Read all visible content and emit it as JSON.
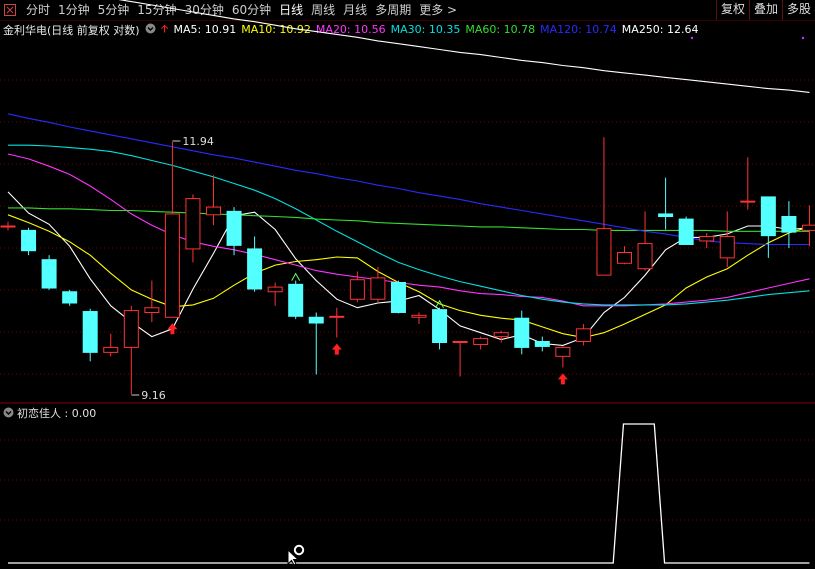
{
  "toolbar": {
    "tabs": [
      "分时",
      "1分钟",
      "5分钟",
      "15分钟",
      "30分钟",
      "60分钟",
      "日线",
      "周线",
      "月线",
      "多周期",
      "更多 >"
    ],
    "active_tab": 6,
    "right_buttons": [
      "复权",
      "叠加",
      "多股"
    ]
  },
  "stock_title": "金利华电(日线 前复权 对数)",
  "ma_labels": [
    {
      "text": "MA5: 10.91",
      "color": "#ffffff"
    },
    {
      "text": "MA10: 10.92",
      "color": "#ffff00"
    },
    {
      "text": "MA20: 10.56",
      "color": "#ff33ff"
    },
    {
      "text": "MA30: 10.35",
      "color": "#00e0e0"
    },
    {
      "text": "MA60: 10.78",
      "color": "#33dd33"
    },
    {
      "text": "MA120: 10.74",
      "color": "#2a2aff"
    },
    {
      "text": "MA250: 12.64",
      "color": "#ffffff"
    }
  ],
  "indicator_label": "初恋佳人 : 0.00",
  "colors": {
    "up": "#ff3232",
    "down": "#54ffff",
    "grid": "#7a0000"
  },
  "chart_data": {
    "type": "candlestick",
    "scale": "log",
    "price_range": [
      9.0,
      12.6
    ],
    "annotations": [
      {
        "text": "11.94",
        "candle": 8,
        "price": 11.94
      },
      {
        "text": "9.16",
        "candle": 6,
        "price": 9.16
      }
    ],
    "candles": [
      {
        "o": 10.93,
        "h": 10.98,
        "l": 10.88,
        "c": 10.93
      },
      {
        "o": 10.88,
        "h": 10.91,
        "l": 10.6,
        "c": 10.65
      },
      {
        "o": 10.55,
        "h": 10.6,
        "l": 10.22,
        "c": 10.24
      },
      {
        "o": 10.2,
        "h": 10.22,
        "l": 10.05,
        "c": 10.08
      },
      {
        "o": 9.99,
        "h": 10.02,
        "l": 9.48,
        "c": 9.57
      },
      {
        "o": 9.57,
        "h": 9.76,
        "l": 9.53,
        "c": 9.62
      },
      {
        "o": 9.62,
        "h": 10.05,
        "l": 9.16,
        "c": 10.0
      },
      {
        "o": 9.98,
        "h": 10.32,
        "l": 9.88,
        "c": 10.03
      },
      {
        "o": 9.93,
        "h": 11.94,
        "l": 9.93,
        "c": 11.07
      },
      {
        "o": 10.67,
        "h": 11.3,
        "l": 10.52,
        "c": 11.25
      },
      {
        "o": 11.06,
        "h": 11.53,
        "l": 10.94,
        "c": 11.15
      },
      {
        "o": 11.1,
        "h": 11.15,
        "l": 10.6,
        "c": 10.71
      },
      {
        "o": 10.67,
        "h": 10.81,
        "l": 10.2,
        "c": 10.23
      },
      {
        "o": 10.2,
        "h": 10.3,
        "l": 10.05,
        "c": 10.25
      },
      {
        "o": 10.28,
        "h": 10.32,
        "l": 9.91,
        "c": 9.94
      },
      {
        "o": 9.93,
        "h": 9.98,
        "l": 9.35,
        "c": 9.87
      },
      {
        "o": 9.93,
        "h": 10.03,
        "l": 9.72,
        "c": 9.94
      },
      {
        "o": 10.12,
        "h": 10.42,
        "l": 10.09,
        "c": 10.33
      },
      {
        "o": 10.12,
        "h": 10.47,
        "l": 10.09,
        "c": 10.35
      },
      {
        "o": 10.3,
        "h": 10.32,
        "l": 9.97,
        "c": 9.98
      },
      {
        "o": 9.93,
        "h": 9.98,
        "l": 9.86,
        "c": 9.95
      },
      {
        "o": 10.01,
        "h": 10.03,
        "l": 9.6,
        "c": 9.67
      },
      {
        "o": 9.68,
        "h": 9.68,
        "l": 9.33,
        "c": 9.68
      },
      {
        "o": 9.65,
        "h": 9.73,
        "l": 9.6,
        "c": 9.71
      },
      {
        "o": 9.73,
        "h": 9.79,
        "l": 9.67,
        "c": 9.77
      },
      {
        "o": 9.92,
        "h": 10.0,
        "l": 9.55,
        "c": 9.62
      },
      {
        "o": 9.68,
        "h": 9.73,
        "l": 9.58,
        "c": 9.63
      },
      {
        "o": 9.53,
        "h": 9.63,
        "l": 9.42,
        "c": 9.62
      },
      {
        "o": 9.68,
        "h": 9.86,
        "l": 9.64,
        "c": 9.81
      },
      {
        "o": 10.38,
        "h": 12.0,
        "l": 10.38,
        "c": 10.9
      },
      {
        "o": 10.51,
        "h": 10.7,
        "l": 10.5,
        "c": 10.63
      },
      {
        "o": 10.45,
        "h": 11.1,
        "l": 10.43,
        "c": 10.73
      },
      {
        "o": 11.07,
        "h": 11.5,
        "l": 10.89,
        "c": 11.04
      },
      {
        "o": 11.01,
        "h": 11.04,
        "l": 10.72,
        "c": 10.72
      },
      {
        "o": 10.76,
        "h": 10.85,
        "l": 10.68,
        "c": 10.81
      },
      {
        "o": 10.57,
        "h": 11.1,
        "l": 10.47,
        "c": 10.81
      },
      {
        "o": 11.22,
        "h": 11.75,
        "l": 11.12,
        "c": 11.22
      },
      {
        "o": 11.27,
        "h": 11.27,
        "l": 10.57,
        "c": 10.82
      },
      {
        "o": 11.04,
        "h": 11.22,
        "l": 10.68,
        "c": 10.86
      },
      {
        "o": 10.88,
        "h": 11.17,
        "l": 10.7,
        "c": 10.94
      }
    ],
    "ma_series": [
      {
        "name": "MA5",
        "color": "#ffffff",
        "values": [
          11.33,
          11.08,
          10.95,
          10.7,
          10.34,
          10.05,
          9.88,
          9.73,
          9.81,
          10.23,
          10.62,
          11.05,
          11.09,
          10.89,
          10.56,
          10.32,
          10.12,
          10.03,
          10.08,
          10.1,
          10.16,
          10.01,
          9.84,
          9.77,
          9.7,
          9.75,
          9.66,
          9.64,
          9.72,
          9.98,
          10.14,
          10.38,
          10.66,
          10.8,
          10.8,
          10.84,
          10.93,
          10.93,
          10.89,
          10.91
        ]
      },
      {
        "name": "MA10",
        "color": "#ffff00",
        "values": [
          11.06,
          10.97,
          10.87,
          10.75,
          10.6,
          10.4,
          10.22,
          10.12,
          10.04,
          10.06,
          10.13,
          10.27,
          10.4,
          10.49,
          10.53,
          10.55,
          10.58,
          10.57,
          10.42,
          10.3,
          10.2,
          10.07,
          10.0,
          9.95,
          9.92,
          9.9,
          9.83,
          9.76,
          9.72,
          9.77,
          9.86,
          9.96,
          10.06,
          10.24,
          10.36,
          10.45,
          10.6,
          10.74,
          10.85,
          10.92
        ]
      },
      {
        "name": "MA20",
        "color": "#ff33ff",
        "values": [
          11.79,
          11.73,
          11.64,
          11.54,
          11.4,
          11.24,
          11.07,
          10.94,
          10.83,
          10.75,
          10.7,
          10.66,
          10.61,
          10.55,
          10.49,
          10.43,
          10.39,
          10.36,
          10.33,
          10.3,
          10.27,
          10.25,
          10.21,
          10.18,
          10.17,
          10.15,
          10.14,
          10.1,
          10.05,
          10.05,
          10.05,
          10.06,
          10.07,
          10.09,
          10.11,
          10.14,
          10.19,
          10.24,
          10.29,
          10.34
        ]
      },
      {
        "name": "MA30",
        "color": "#00e0e0",
        "values": [
          11.9,
          11.9,
          11.89,
          11.87,
          11.85,
          11.82,
          11.77,
          11.71,
          11.65,
          11.58,
          11.51,
          11.43,
          11.35,
          11.25,
          11.13,
          11.0,
          10.87,
          10.75,
          10.63,
          10.52,
          10.44,
          10.37,
          10.31,
          10.26,
          10.21,
          10.16,
          10.12,
          10.09,
          10.07,
          10.06,
          10.06,
          10.06,
          10.06,
          10.07,
          10.09,
          10.11,
          10.14,
          10.17,
          10.19,
          10.21
        ]
      },
      {
        "name": "MA60",
        "color": "#33dd33",
        "values": [
          11.14,
          11.14,
          11.13,
          11.13,
          11.12,
          11.11,
          11.11,
          11.1,
          11.09,
          11.08,
          11.07,
          11.06,
          11.05,
          11.04,
          11.03,
          11.01,
          11.0,
          10.99,
          10.97,
          10.96,
          10.95,
          10.94,
          10.93,
          10.92,
          10.92,
          10.91,
          10.9,
          10.89,
          10.89,
          10.88,
          10.88,
          10.88,
          10.88,
          10.88,
          10.88,
          10.87,
          10.87,
          10.87,
          10.87,
          10.87
        ]
      },
      {
        "name": "MA120",
        "color": "#2a2aff",
        "values": [
          12.3,
          12.24,
          12.19,
          12.13,
          12.08,
          12.03,
          11.98,
          11.93,
          11.88,
          11.83,
          11.78,
          11.74,
          11.69,
          11.64,
          11.59,
          11.55,
          11.5,
          11.46,
          11.41,
          11.37,
          11.32,
          11.28,
          11.24,
          11.19,
          11.15,
          11.11,
          11.07,
          11.03,
          10.99,
          10.95,
          10.91,
          10.87,
          10.84,
          10.8,
          10.76,
          10.74,
          10.73,
          10.72,
          10.72,
          10.72
        ]
      },
      {
        "name": "MA250",
        "color": "#ffffff",
        "values": [
          14.16,
          14.11,
          14.05,
          14.0,
          13.95,
          13.89,
          13.84,
          13.79,
          13.74,
          13.69,
          13.64,
          13.59,
          13.55,
          13.5,
          13.45,
          13.41,
          13.37,
          13.33,
          13.28,
          13.24,
          13.2,
          13.16,
          13.12,
          13.09,
          13.05,
          13.01,
          12.98,
          12.94,
          12.91,
          12.87,
          12.84,
          12.81,
          12.78,
          12.75,
          12.72,
          12.69,
          12.66,
          12.63,
          12.61,
          12.58
        ]
      }
    ],
    "buy_signal_candles": [
      8,
      16,
      27
    ],
    "triangle_marks": [
      14,
      21
    ],
    "indicator": {
      "name": "初恋佳人",
      "values": [
        0,
        0,
        0,
        0,
        0,
        0,
        0,
        0,
        0,
        0,
        0,
        0,
        0,
        0,
        0,
        0,
        0,
        0,
        0,
        0,
        0,
        0,
        0,
        0,
        0,
        0,
        0,
        0,
        0,
        0,
        1,
        1,
        0,
        0,
        0,
        0,
        0,
        0,
        0,
        0
      ]
    }
  }
}
